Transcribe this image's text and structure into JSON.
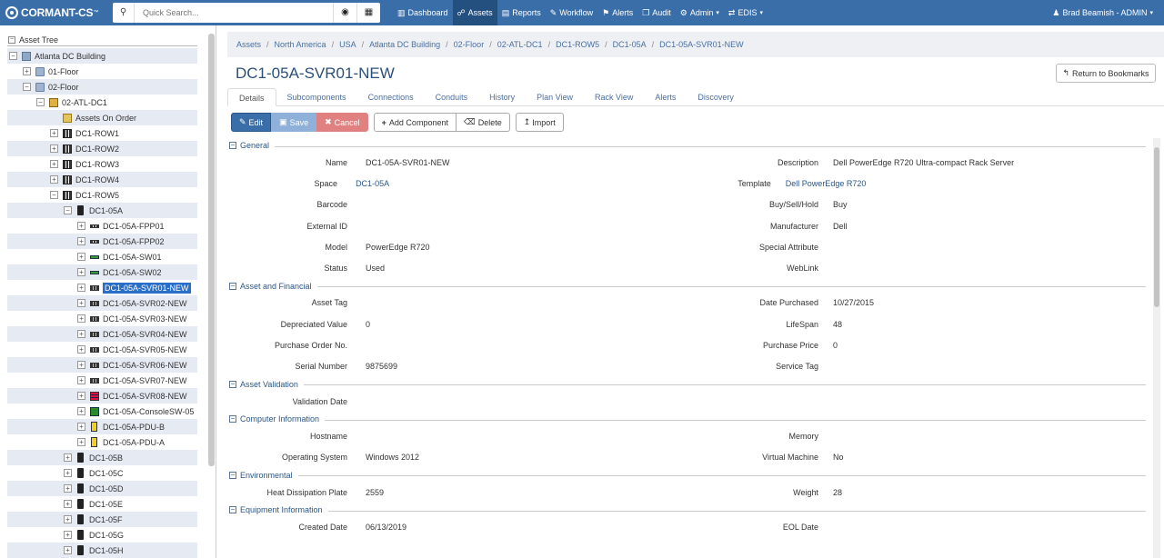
{
  "app": {
    "logo_text": "CORMANT-CS",
    "logo_tm": "™"
  },
  "search": {
    "placeholder": "Quick Search..."
  },
  "nav": [
    {
      "label": "Dashboard",
      "icon": "chart-icon",
      "glyph": "▥",
      "active": false
    },
    {
      "label": "Assets",
      "icon": "sitemap-icon",
      "glyph": "☍",
      "active": true
    },
    {
      "label": "Reports",
      "icon": "file-icon",
      "glyph": "▤",
      "active": false
    },
    {
      "label": "Workflow",
      "icon": "pencil-icon",
      "glyph": "✎",
      "active": false
    },
    {
      "label": "Alerts",
      "icon": "bell-icon",
      "glyph": "⚑",
      "active": false
    },
    {
      "label": "Audit",
      "icon": "copy-icon",
      "glyph": "❐",
      "active": false
    },
    {
      "label": "Admin",
      "icon": "cogs-icon",
      "glyph": "⚙",
      "active": false,
      "dropdown": true
    },
    {
      "label": "EDIS",
      "icon": "transfer-icon",
      "glyph": "⇄",
      "active": false,
      "dropdown": true
    }
  ],
  "user": {
    "name": "Brad Beamish - ADMIN",
    "icon_glyph": "♟"
  },
  "sidebar": {
    "header": "Asset Tree",
    "items": [
      {
        "label": "Atlanta DC Building",
        "indent": 0,
        "exp": "−",
        "icon": "bldg",
        "shade": true
      },
      {
        "label": "01-Floor",
        "indent": 1,
        "exp": "+",
        "icon": "floor",
        "shade": false
      },
      {
        "label": "02-Floor",
        "indent": 1,
        "exp": "−",
        "icon": "floor",
        "shade": true
      },
      {
        "label": "02-ATL-DC1",
        "indent": 2,
        "exp": "−",
        "icon": "room",
        "shade": false
      },
      {
        "label": "Assets On Order",
        "indent": 3,
        "exp": "",
        "icon": "order",
        "shade": true
      },
      {
        "label": "DC1-ROW1",
        "indent": 3,
        "exp": "+",
        "icon": "rowi",
        "shade": false
      },
      {
        "label": "DC1-ROW2",
        "indent": 3,
        "exp": "+",
        "icon": "rowi",
        "shade": true
      },
      {
        "label": "DC1-ROW3",
        "indent": 3,
        "exp": "+",
        "icon": "rowi",
        "shade": false
      },
      {
        "label": "DC1-ROW4",
        "indent": 3,
        "exp": "+",
        "icon": "rowi",
        "shade": true
      },
      {
        "label": "DC1-ROW5",
        "indent": 3,
        "exp": "−",
        "icon": "rowi",
        "shade": false
      },
      {
        "label": "DC1-05A",
        "indent": 4,
        "exp": "−",
        "icon": "rack",
        "shade": true
      },
      {
        "label": "DC1-05A-FPP01",
        "indent": 5,
        "exp": "+",
        "icon": "fpp",
        "shade": false
      },
      {
        "label": "DC1-05A-FPP02",
        "indent": 5,
        "exp": "+",
        "icon": "fpp",
        "shade": true
      },
      {
        "label": "DC1-05A-SW01",
        "indent": 5,
        "exp": "+",
        "icon": "sw",
        "shade": false
      },
      {
        "label": "DC1-05A-SW02",
        "indent": 5,
        "exp": "+",
        "icon": "sw",
        "shade": true
      },
      {
        "label": "DC1-05A-SVR01-NEW",
        "indent": 5,
        "exp": "+",
        "icon": "svr",
        "shade": false,
        "selected": true
      },
      {
        "label": "DC1-05A-SVR02-NEW",
        "indent": 5,
        "exp": "+",
        "icon": "svr",
        "shade": true
      },
      {
        "label": "DC1-05A-SVR03-NEW",
        "indent": 5,
        "exp": "+",
        "icon": "svr",
        "shade": false
      },
      {
        "label": "DC1-05A-SVR04-NEW",
        "indent": 5,
        "exp": "+",
        "icon": "svr",
        "shade": true
      },
      {
        "label": "DC1-05A-SVR05-NEW",
        "indent": 5,
        "exp": "+",
        "icon": "svr",
        "shade": false
      },
      {
        "label": "DC1-05A-SVR06-NEW",
        "indent": 5,
        "exp": "+",
        "icon": "svr",
        "shade": true
      },
      {
        "label": "DC1-05A-SVR07-NEW",
        "indent": 5,
        "exp": "+",
        "icon": "svr",
        "shade": false
      },
      {
        "label": "DC1-05A-SVR08-NEW",
        "indent": 5,
        "exp": "+",
        "icon": "svr8",
        "shade": true
      },
      {
        "label": "DC1-05A-ConsoleSW-05",
        "indent": 5,
        "exp": "+",
        "icon": "con",
        "shade": false
      },
      {
        "label": "DC1-05A-PDU-B",
        "indent": 5,
        "exp": "+",
        "icon": "pdu",
        "shade": true
      },
      {
        "label": "DC1-05A-PDU-A",
        "indent": 5,
        "exp": "+",
        "icon": "pdu",
        "shade": false
      },
      {
        "label": "DC1-05B",
        "indent": 4,
        "exp": "+",
        "icon": "rack",
        "shade": true
      },
      {
        "label": "DC1-05C",
        "indent": 4,
        "exp": "+",
        "icon": "rack",
        "shade": false
      },
      {
        "label": "DC1-05D",
        "indent": 4,
        "exp": "+",
        "icon": "rack",
        "shade": true
      },
      {
        "label": "DC1-05E",
        "indent": 4,
        "exp": "+",
        "icon": "rack",
        "shade": false
      },
      {
        "label": "DC1-05F",
        "indent": 4,
        "exp": "+",
        "icon": "rack",
        "shade": true
      },
      {
        "label": "DC1-05G",
        "indent": 4,
        "exp": "+",
        "icon": "rack",
        "shade": false
      },
      {
        "label": "DC1-05H",
        "indent": 4,
        "exp": "+",
        "icon": "rack",
        "shade": true
      }
    ]
  },
  "breadcrumb": [
    "Assets",
    "North America",
    "USA",
    "Atlanta DC Building",
    "02-Floor",
    "02-ATL-DC1",
    "DC1-ROW5",
    "DC1-05A",
    "DC1-05A-SVR01-NEW"
  ],
  "page": {
    "title": "DC1-05A-SVR01-NEW",
    "return_label": "Return to Bookmarks",
    "return_glyph": "↰"
  },
  "tabs": [
    "Details",
    "Subcomponents",
    "Connections",
    "Conduits",
    "History",
    "Plan View",
    "Rack View",
    "Alerts",
    "Discovery"
  ],
  "actions": {
    "edit": "Edit",
    "save": "Save",
    "cancel": "Cancel",
    "add": "Add Component",
    "delete": "Delete",
    "import": "Import"
  },
  "sections": [
    {
      "title": "General",
      "rows": [
        {
          "l1": "Name",
          "v1": "DC1-05A-SVR01-NEW",
          "l2": "Description",
          "v2": "Dell PowerEdge R720 Ultra-compact Rack Server"
        },
        {
          "l1": "Space",
          "v1": "DC1-05A",
          "v1link": true,
          "l2": "Template",
          "v2": "Dell PowerEdge R720",
          "v2link": true
        },
        {
          "l1": "Barcode",
          "v1": "",
          "l2": "Buy/Sell/Hold",
          "v2": "Buy"
        },
        {
          "l1": "External ID",
          "v1": "",
          "l2": "Manufacturer",
          "v2": "Dell"
        },
        {
          "l1": "Model",
          "v1": "PowerEdge R720",
          "l2": "Special Attribute",
          "v2": ""
        },
        {
          "l1": "Status",
          "v1": "Used",
          "l2": "WebLink",
          "v2": ""
        }
      ]
    },
    {
      "title": "Asset and Financial",
      "rows": [
        {
          "l1": "Asset Tag",
          "v1": "",
          "l2": "Date Purchased",
          "v2": "10/27/2015"
        },
        {
          "l1": "Depreciated Value",
          "v1": "0",
          "l2": "LifeSpan",
          "v2": "48"
        },
        {
          "l1": "Purchase Order No.",
          "v1": "",
          "l2": "Purchase Price",
          "v2": "0"
        },
        {
          "l1": "Serial Number",
          "v1": "9875699",
          "l2": "Service Tag",
          "v2": ""
        }
      ]
    },
    {
      "title": "Asset Validation",
      "rows": [
        {
          "l1": "Validation Date",
          "v1": "",
          "l2": "",
          "v2": ""
        }
      ]
    },
    {
      "title": "Computer Information",
      "rows": [
        {
          "l1": "Hostname",
          "v1": "",
          "l2": "Memory",
          "v2": ""
        },
        {
          "l1": "Operating System",
          "v1": "Windows 2012",
          "l2": "Virtual Machine",
          "v2": "No"
        }
      ]
    },
    {
      "title": "Environmental",
      "rows": [
        {
          "l1": "Heat Dissipation Plate",
          "v1": "2559",
          "l2": "Weight",
          "v2": "28"
        }
      ]
    },
    {
      "title": "Equipment Information",
      "rows": [
        {
          "l1": "Created Date",
          "v1": "06/13/2019",
          "l2": "EOL Date",
          "v2": ""
        }
      ]
    }
  ]
}
